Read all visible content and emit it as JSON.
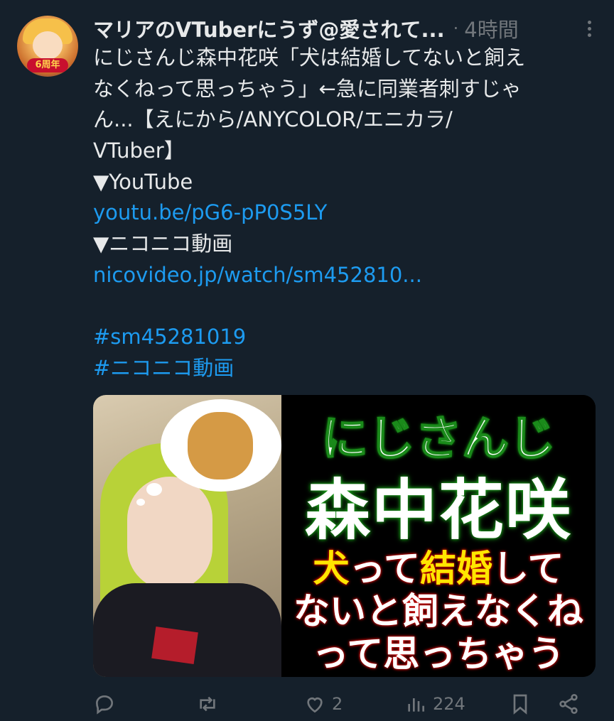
{
  "tweet": {
    "author_name": "マリアのVTuberにうず@愛されて...",
    "dot": "·",
    "time": "4時間",
    "lines": [
      {
        "text": "にじさんじ森中花咲「犬は結婚してないと飼え",
        "link": false
      },
      {
        "text": "なくねって思っちゃう」←急に同業者刺すじゃ",
        "link": false
      },
      {
        "text": "ん...【えにから/ANYCOLOR/エニカラ/",
        "link": false
      },
      {
        "text": "VTuber】",
        "link": false
      },
      {
        "text": "▼YouTube",
        "link": false
      },
      {
        "text": "youtu.be/pG6-pP0S5LY",
        "link": true
      },
      {
        "text": "▼ニコニコ動画",
        "link": false
      },
      {
        "text": "nicovideo.jp/watch/sm452810...",
        "link": true
      },
      {
        "text": "",
        "link": false
      },
      {
        "text": "#sm45281019",
        "link": true
      },
      {
        "text": "#ニコニコ動画",
        "link": true
      }
    ]
  },
  "avatar": {
    "badge": "6周年"
  },
  "thumbnail": {
    "title_line1": "にじさんじ",
    "title_line2": "森中花咲",
    "quote_seg1_yellow": "犬",
    "quote_seg2": "って",
    "quote_seg3_yellow": "結婚",
    "quote_seg4": "して",
    "quote_line2": "ないと飼えなくね",
    "quote_line3": "って思っちゃう"
  },
  "actions": {
    "reply_count": "",
    "retweet_count": "",
    "like_count": "2",
    "views_count": "224"
  },
  "colors": {
    "background": "#15202b",
    "link": "#1d9bf0",
    "muted": "#71767b"
  }
}
